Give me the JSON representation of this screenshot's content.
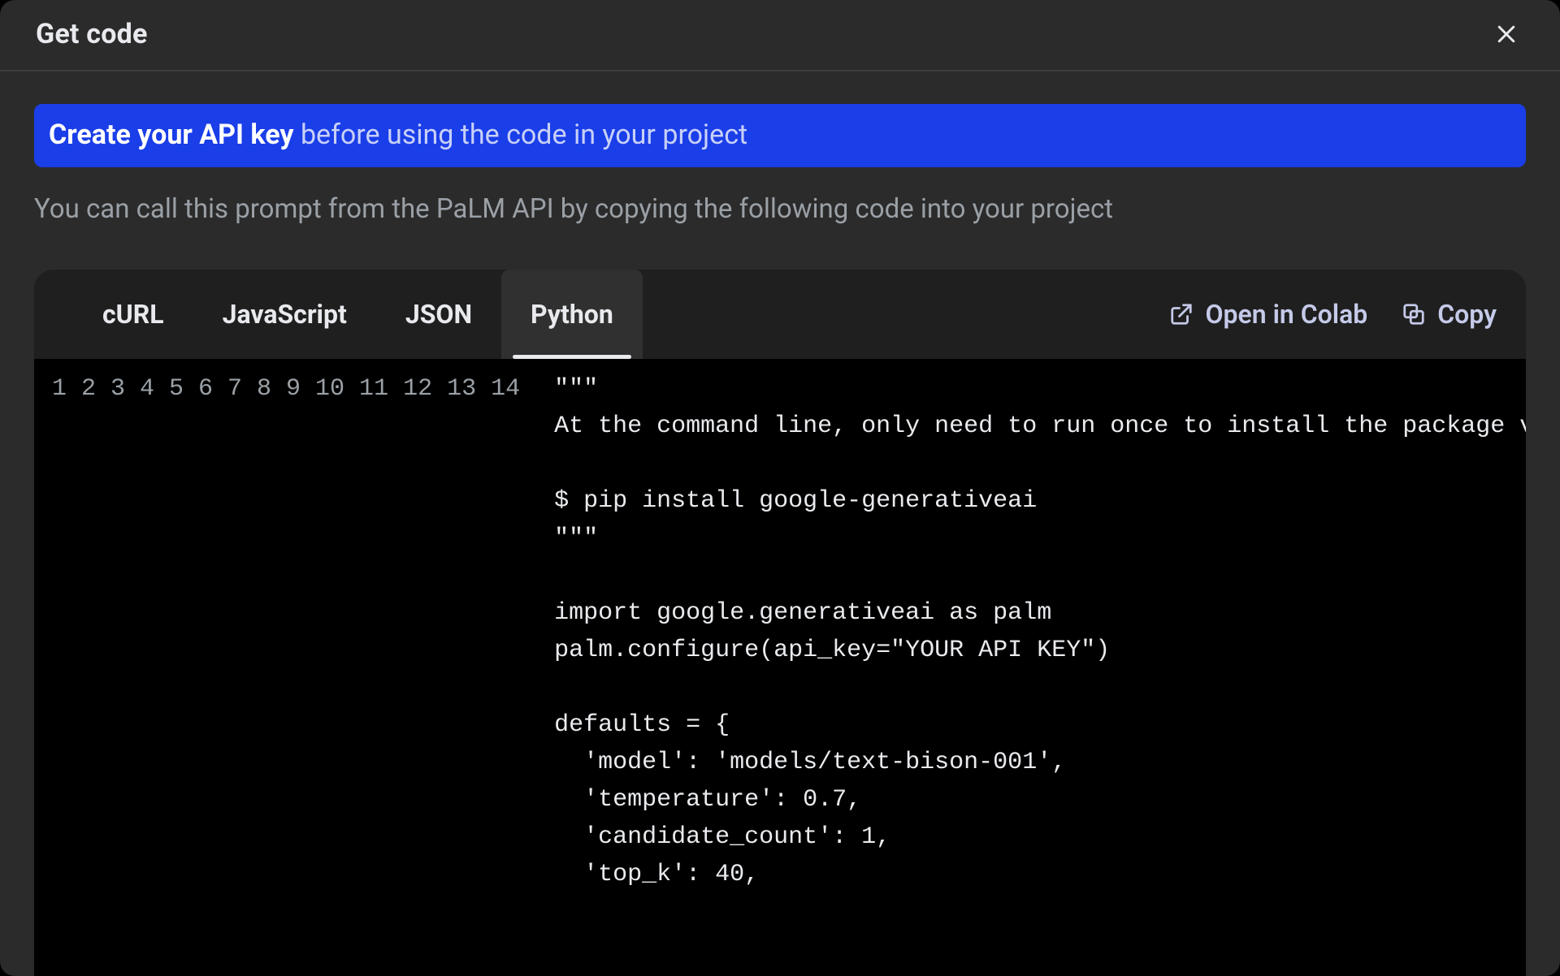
{
  "dialog": {
    "title": "Get code"
  },
  "banner": {
    "link_text": "Create your API key",
    "rest_text": " before using the code in your project"
  },
  "subtext": "You can call this prompt from the PaLM API by copying the following code into your project",
  "tabs": [
    {
      "label": "cURL",
      "active": false
    },
    {
      "label": "JavaScript",
      "active": false
    },
    {
      "label": "JSON",
      "active": false
    },
    {
      "label": "Python",
      "active": true
    }
  ],
  "actions": {
    "open_in_colab": "Open in Colab",
    "copy": "Copy"
  },
  "code_lines": [
    "\"\"\"",
    "At the command line, only need to run once to install the package via pip:",
    "",
    "$ pip install google-generativeai",
    "\"\"\"",
    "",
    "import google.generativeai as palm",
    "palm.configure(api_key=\"YOUR API KEY\")",
    "",
    "defaults = {",
    "  'model': 'models/text-bison-001',",
    "  'temperature': 0.7,",
    "  'candidate_count': 1,",
    "  'top_k': 40,"
  ]
}
